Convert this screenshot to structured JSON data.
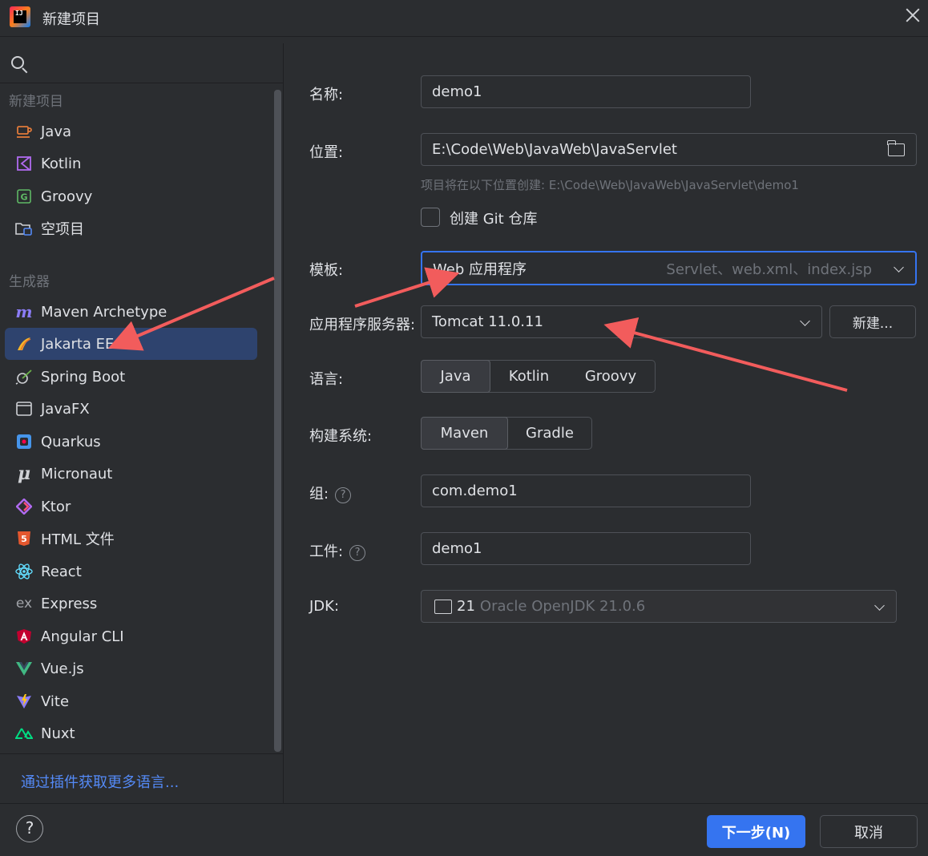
{
  "window": {
    "title": "新建项目",
    "logo_text": "IJ"
  },
  "sidebar": {
    "section_new_project": "新建项目",
    "section_generators": "生成器",
    "new_project_items": [
      {
        "label": "Java",
        "icon": "java-icon"
      },
      {
        "label": "Kotlin",
        "icon": "kotlin-icon"
      },
      {
        "label": "Groovy",
        "icon": "groovy-icon"
      },
      {
        "label": "空项目",
        "icon": "empty-project-icon"
      }
    ],
    "generator_items": [
      {
        "label": "Maven Archetype",
        "icon": "maven-icon"
      },
      {
        "label": "Jakarta EE",
        "icon": "jakarta-ee-icon",
        "selected": true
      },
      {
        "label": "Spring Boot",
        "icon": "spring-boot-icon"
      },
      {
        "label": "JavaFX",
        "icon": "javafx-icon"
      },
      {
        "label": "Quarkus",
        "icon": "quarkus-icon"
      },
      {
        "label": "Micronaut",
        "icon": "micronaut-icon"
      },
      {
        "label": "Ktor",
        "icon": "ktor-icon"
      },
      {
        "label": "HTML 文件",
        "icon": "html-icon"
      },
      {
        "label": "React",
        "icon": "react-icon"
      },
      {
        "label": "Express",
        "icon": "express-icon"
      },
      {
        "label": "Angular CLI",
        "icon": "angular-icon"
      },
      {
        "label": "Vue.js",
        "icon": "vue-icon"
      },
      {
        "label": "Vite",
        "icon": "vite-icon"
      },
      {
        "label": "Nuxt",
        "icon": "nuxt-icon"
      }
    ],
    "plugins_link": "通过插件获取更多语言..."
  },
  "form": {
    "name_label": "名称:",
    "name_value": "demo1",
    "location_label": "位置:",
    "location_value": "E:\\Code\\Web\\JavaWeb\\JavaServlet",
    "location_hint": "项目将在以下位置创建: E:\\Code\\Web\\JavaWeb\\JavaServlet\\demo1",
    "git_checkbox_label": "创建 Git 仓库",
    "template_label": "模板:",
    "template_value": "Web 应用程序",
    "template_hint": "Servlet、web.xml、index.jsp",
    "server_label": "应用程序服务器:",
    "server_value": "Tomcat 11.0.11",
    "server_new_button": "新建...",
    "language_label": "语言:",
    "languages": [
      "Java",
      "Kotlin",
      "Groovy"
    ],
    "language_selected": "Java",
    "build_label": "构建系统:",
    "build_systems": [
      "Maven",
      "Gradle"
    ],
    "build_selected": "Maven",
    "group_label": "组:",
    "group_value": "com.demo1",
    "artifact_label": "工件:",
    "artifact_value": "demo1",
    "jdk_label": "JDK:",
    "jdk_version": "21",
    "jdk_name": "Oracle OpenJDK 21.0.6"
  },
  "footer": {
    "help": "?",
    "next_button": "下一步(N)",
    "cancel_button": "取消"
  },
  "colors": {
    "background": "#2b2d30",
    "selection": "#2e436e",
    "accent": "#3574f0",
    "link": "#548af7",
    "annotation_arrow": "#f25c5c"
  }
}
